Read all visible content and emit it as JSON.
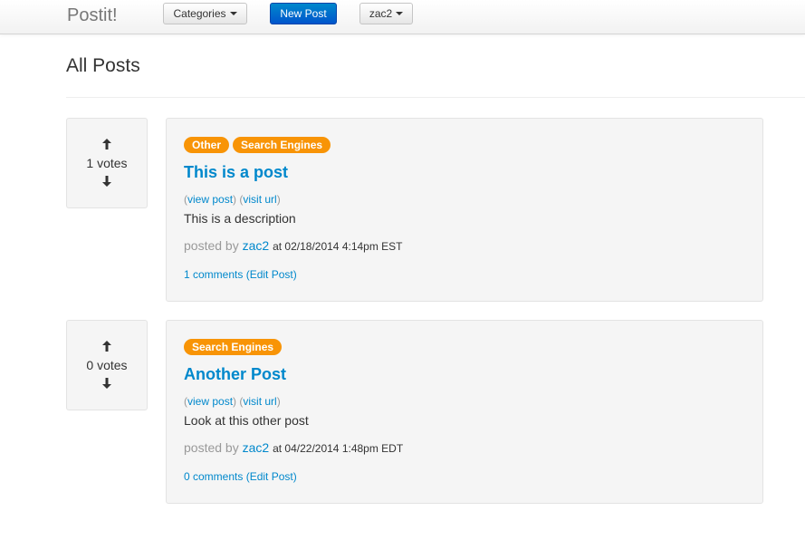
{
  "navbar": {
    "brand": "Postit!",
    "categories_label": "Categories",
    "new_post_label": "New Post",
    "user_label": "zac2"
  },
  "page": {
    "title": "All Posts"
  },
  "icons": {
    "up": "arrow-up-icon",
    "down": "arrow-down-icon",
    "caret": "caret-down-icon"
  },
  "colors": {
    "link": "#0088cc",
    "tag": "#f89406",
    "primary_button": "#0070cc"
  },
  "posts": [
    {
      "votes": "1 votes",
      "tags": [
        "Other",
        "Search Engines"
      ],
      "title": "This is a post",
      "view_post": "view post",
      "visit_url": "visit url",
      "description": "This is a description",
      "posted_by": "posted by",
      "author": "zac2",
      "timestamp": "at 02/18/2014 4:14pm EST",
      "comments": "1 comments",
      "edit": "(Edit Post)"
    },
    {
      "votes": "0 votes",
      "tags": [
        "Search Engines"
      ],
      "title": "Another Post",
      "view_post": "view post",
      "visit_url": "visit url",
      "description": "Look at this other post",
      "posted_by": "posted by",
      "author": "zac2",
      "timestamp": "at 04/22/2014 1:48pm EDT",
      "comments": "0 comments",
      "edit": "(Edit Post)"
    }
  ]
}
